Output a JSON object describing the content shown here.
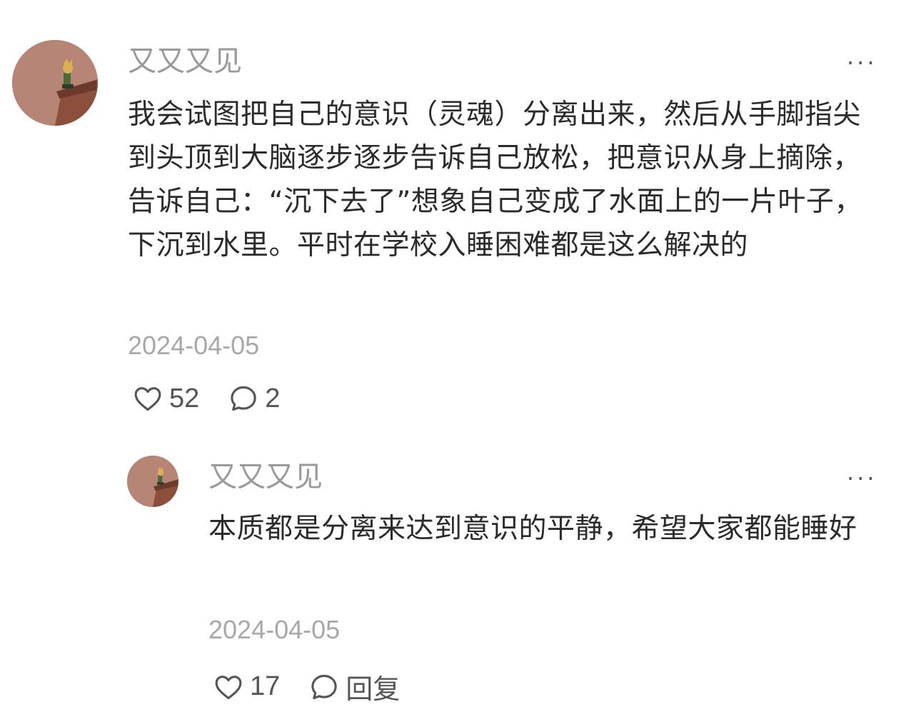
{
  "comment": {
    "username": "又又又见",
    "more_label": "···",
    "text": "我会试图把自己的意识（灵魂）分离出来，然后从手脚指尖到头顶到大脑逐步逐步告诉自己放松，把意识从身上摘除，告诉自己：“沉下去了”想象自己变成了水面上的一片叶子，下沉到水里。平时在学校入睡困难都是这么解决的",
    "date": "2024-04-05",
    "likes": "52",
    "replies": "2",
    "icons": {
      "like": "heart-icon",
      "reply": "speech-bubble-icon",
      "more": "more-options-icon"
    }
  },
  "reply": {
    "username": "又又又见",
    "more_label": "···",
    "text": "本质都是分离来达到意识的平静，希望大家都能睡好",
    "date": "2024-04-05",
    "likes": "17",
    "reply_label": "回复",
    "icons": {
      "like": "heart-icon",
      "reply": "speech-bubble-icon",
      "more": "more-options-icon"
    }
  },
  "colors": {
    "text": "#2b2b2b",
    "muted": "#9a9a9a",
    "icon": "#555555",
    "background": "#ffffff"
  }
}
